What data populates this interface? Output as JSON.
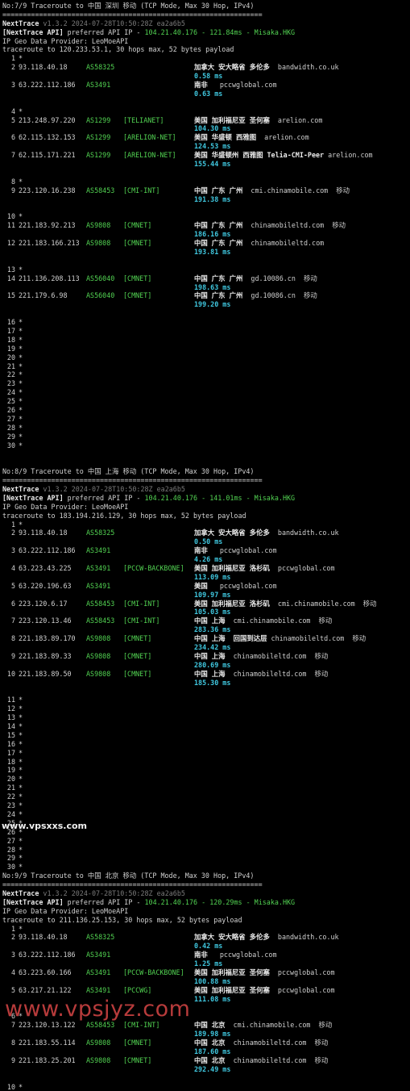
{
  "separator": "================================================================",
  "watermarks": {
    "mid": "www.vpsxxs.com",
    "bottom": "www.vpsjyz.com"
  },
  "colors": {
    "asn": "#52d352",
    "rtt": "#40c8e0",
    "background": "#000000"
  },
  "sections": [
    {
      "header": "No:7/9 Traceroute to 中国 深圳 移动 (TCP Mode, Max 30 Hop, IPv4)",
      "nt_name": "NextTrace",
      "nt_meta": " v1.3.2 2024-07-28T10:50:28Z ea2a6b5",
      "api_label": "[NextTrace API]",
      "api_text": " preferred API IP - ",
      "api_ip": "104.21.40.176",
      "api_sep": " - ",
      "api_ms": "121.84ms",
      "api_dash": " - ",
      "api_node": "Misaka.HKG",
      "provider": "IP Geo Data Provider: LeoMoeAPI",
      "route": "traceroute to 120.233.53.1, 30 hops max, 52 bytes payload",
      "hops": [
        {
          "n": "1",
          "star": true
        },
        {
          "n": "2",
          "ip": "93.118.40.18",
          "asn": "AS58325",
          "tag": "",
          "loc": "加拿大 安大略省 多伦多  ",
          "host": "bandwidth.co.uk",
          "rtt": "0.58 ms"
        },
        {
          "n": "3",
          "ip": "63.222.112.186",
          "asn": "AS3491",
          "tag": "",
          "loc": "南非   ",
          "host": "pccwglobal.com",
          "rtt": "0.63 ms"
        },
        {
          "n": "4",
          "star": true
        },
        {
          "n": "5",
          "ip": "213.248.97.220",
          "asn": "AS1299",
          "tag": "[TELIANET]",
          "loc": "美国 加利福尼亚 圣何塞  ",
          "host": "arelion.com",
          "rtt": "104.30 ms"
        },
        {
          "n": "6",
          "ip": "62.115.132.153",
          "asn": "AS1299",
          "tag": "[ARELION-NET]",
          "loc": "美国 华盛顿 西雅图  ",
          "host": "arelion.com",
          "rtt": "124.53 ms"
        },
        {
          "n": "7",
          "ip": "62.115.171.221",
          "asn": "AS1299",
          "tag": "[ARELION-NET]",
          "loc": "美国 华盛顿州 西雅图 Telia-CMI-Peer ",
          "host": "arelion.com",
          "rtt": "155.44 ms"
        },
        {
          "n": "8",
          "star": true
        },
        {
          "n": "9",
          "ip": "223.120.16.238",
          "asn": "AS58453",
          "tag": "[CMI-INT]",
          "loc": "中国 广东 广州  ",
          "host": "cmi.chinamobile.com  移动",
          "rtt": "191.38 ms"
        },
        {
          "n": "10",
          "star": true
        },
        {
          "n": "11",
          "ip": "221.183.92.213",
          "asn": "AS9808",
          "tag": "[CMNET]",
          "loc": "中国 广东 广州  ",
          "host": "chinamobileltd.com  移动",
          "rtt": "186.16 ms"
        },
        {
          "n": "12",
          "ip": "221.183.166.213",
          "asn": "AS9808",
          "tag": "[CMNET]",
          "loc": "中国 广东 广州  ",
          "host": "chinamobileltd.com",
          "rtt": "193.81 ms"
        },
        {
          "n": "13",
          "star": true
        },
        {
          "n": "14",
          "ip": "211.136.208.113",
          "asn": "AS56040",
          "tag": "[CMNET]",
          "loc": "中国 广东 广州  ",
          "host": "gd.10086.cn  移动",
          "rtt": "198.63 ms"
        },
        {
          "n": "15",
          "ip": "221.179.6.98",
          "asn": "AS56040",
          "tag": "[CMNET]",
          "loc": "中国 广东 广州  ",
          "host": "gd.10086.cn  移动",
          "rtt": "199.20 ms"
        },
        {
          "n": "16",
          "star": true
        },
        {
          "n": "17",
          "star": true
        },
        {
          "n": "18",
          "star": true
        },
        {
          "n": "19",
          "star": true
        },
        {
          "n": "20",
          "star": true
        },
        {
          "n": "21",
          "star": true
        },
        {
          "n": "22",
          "star": true
        },
        {
          "n": "23",
          "star": true
        },
        {
          "n": "24",
          "star": true
        },
        {
          "n": "25",
          "star": true
        },
        {
          "n": "26",
          "star": true
        },
        {
          "n": "27",
          "star": true
        },
        {
          "n": "28",
          "star": true
        },
        {
          "n": "29",
          "star": true
        },
        {
          "n": "30",
          "star": true
        }
      ]
    },
    {
      "header": "No:8/9 Traceroute to 中国 上海 移动 (TCP Mode, Max 30 Hop, IPv4)",
      "nt_name": "NextTrace",
      "nt_meta": " v1.3.2 2024-07-28T10:50:28Z ea2a6b5",
      "api_label": "[NextTrace API]",
      "api_text": " preferred API IP - ",
      "api_ip": "104.21.40.176",
      "api_sep": " - ",
      "api_ms": "141.01ms",
      "api_dash": " - ",
      "api_node": "Misaka.HKG",
      "provider": "IP Geo Data Provider: LeoMoeAPI",
      "route": "traceroute to 183.194.216.129, 30 hops max, 52 bytes payload",
      "hops": [
        {
          "n": "1",
          "star": true
        },
        {
          "n": "2",
          "ip": "93.118.40.18",
          "asn": "AS58325",
          "tag": "",
          "loc": "加拿大 安大略省 多伦多  ",
          "host": "bandwidth.co.uk",
          "rtt": "0.50 ms"
        },
        {
          "n": "3",
          "ip": "63.222.112.186",
          "asn": "AS3491",
          "tag": "",
          "loc": "南非   ",
          "host": "pccwglobal.com",
          "rtt": "4.26 ms"
        },
        {
          "n": "4",
          "ip": "63.223.43.225",
          "asn": "AS3491",
          "tag": "[PCCW-BACKBONE]",
          "loc": "美国 加利福尼亚 洛杉矶  ",
          "host": "pccwglobal.com",
          "rtt": "113.09 ms"
        },
        {
          "n": "5",
          "ip": "63.220.196.63",
          "asn": "AS3491",
          "tag": "",
          "loc": "美国   ",
          "host": "pccwglobal.com",
          "rtt": "109.97 ms"
        },
        {
          "n": "6",
          "ip": "223.120.6.17",
          "asn": "AS58453",
          "tag": "[CMI-INT]",
          "loc": "美国 加利福尼亚 洛杉矶  ",
          "host": "cmi.chinamobile.com  移动",
          "rtt": "105.03 ms"
        },
        {
          "n": "7",
          "ip": "223.120.13.46",
          "asn": "AS58453",
          "tag": "[CMI-INT]",
          "loc": "中国 上海  ",
          "host": "cmi.chinamobile.com  移动",
          "rtt": "283.36 ms"
        },
        {
          "n": "8",
          "ip": "221.183.89.170",
          "asn": "AS9808",
          "tag": "[CMNET]",
          "loc": "中国 上海  回国到达层 ",
          "host": "chinamobileltd.com  移动",
          "rtt": "234.42 ms"
        },
        {
          "n": "9",
          "ip": "221.183.89.33",
          "asn": "AS9808",
          "tag": "[CMNET]",
          "loc": "中国 上海  ",
          "host": "chinamobileltd.com  移动",
          "rtt": "280.69 ms"
        },
        {
          "n": "10",
          "ip": "221.183.89.50",
          "asn": "AS9808",
          "tag": "[CMNET]",
          "loc": "中国 上海  ",
          "host": "chinamobileltd.com  移动",
          "rtt": "185.30 ms"
        },
        {
          "n": "11",
          "star": true
        },
        {
          "n": "12",
          "star": true
        },
        {
          "n": "13",
          "star": true
        },
        {
          "n": "14",
          "star": true
        },
        {
          "n": "15",
          "star": true
        },
        {
          "n": "16",
          "star": true
        },
        {
          "n": "17",
          "star": true
        },
        {
          "n": "18",
          "star": true
        },
        {
          "n": "19",
          "star": true
        },
        {
          "n": "20",
          "star": true
        },
        {
          "n": "21",
          "star": true
        },
        {
          "n": "22",
          "star": true
        },
        {
          "n": "23",
          "star": true
        },
        {
          "n": "24",
          "star": true
        },
        {
          "n": "25",
          "star": true
        },
        {
          "n": "26",
          "star": true
        },
        {
          "n": "27",
          "star": true
        },
        {
          "n": "28",
          "star": true
        },
        {
          "n": "29",
          "star": true
        },
        {
          "n": "30",
          "star": true
        }
      ]
    },
    {
      "header": "No:9/9 Traceroute to 中国 北京 移动 (TCP Mode, Max 30 Hop, IPv4)",
      "nt_name": "NextTrace",
      "nt_meta": " v1.3.2 2024-07-28T10:50:28Z ea2a6b5",
      "api_label": "[NextTrace API]",
      "api_text": " preferred API IP - ",
      "api_ip": "104.21.40.176",
      "api_sep": " - ",
      "api_ms": "120.29ms",
      "api_dash": " - ",
      "api_node": "Misaka.HKG",
      "provider": "IP Geo Data Provider: LeoMoeAPI",
      "route": "traceroute to 211.136.25.153, 30 hops max, 52 bytes payload",
      "hops": [
        {
          "n": "1",
          "star": true
        },
        {
          "n": "2",
          "ip": "93.118.40.18",
          "asn": "AS58325",
          "tag": "",
          "loc": "加拿大 安大略省 多伦多  ",
          "host": "bandwidth.co.uk",
          "rtt": "0.42 ms"
        },
        {
          "n": "3",
          "ip": "63.222.112.186",
          "asn": "AS3491",
          "tag": "",
          "loc": "南非   ",
          "host": "pccwglobal.com",
          "rtt": "1.25 ms"
        },
        {
          "n": "4",
          "ip": "63.223.60.166",
          "asn": "AS3491",
          "tag": "[PCCW-BACKBONE]",
          "loc": "美国 加利福尼亚 圣何塞  ",
          "host": "pccwglobal.com",
          "rtt": "100.88 ms"
        },
        {
          "n": "5",
          "ip": "63.217.21.122",
          "asn": "AS3491",
          "tag": "[PCCWG]",
          "loc": "美国 加利福尼亚 圣何塞  ",
          "host": "pccwglobal.com",
          "rtt": "111.08 ms"
        },
        {
          "n": "6",
          "star": true
        },
        {
          "n": "7",
          "ip": "223.120.13.122",
          "asn": "AS58453",
          "tag": "[CMI-INT]",
          "loc": "中国 北京  ",
          "host": "cmi.chinamobile.com  移动",
          "rtt": "189.98 ms"
        },
        {
          "n": "8",
          "ip": "221.183.55.114",
          "asn": "AS9808",
          "tag": "[CMNET]",
          "loc": "中国 北京  ",
          "host": "chinamobileltd.com  移动",
          "rtt": "187.60 ms"
        },
        {
          "n": "9",
          "ip": "221.183.25.201",
          "asn": "AS9808",
          "tag": "[CMNET]",
          "loc": "中国 北京  ",
          "host": "chinamobileltd.com  移动",
          "rtt": "292.49 ms"
        },
        {
          "n": "10",
          "star": true
        }
      ]
    }
  ]
}
